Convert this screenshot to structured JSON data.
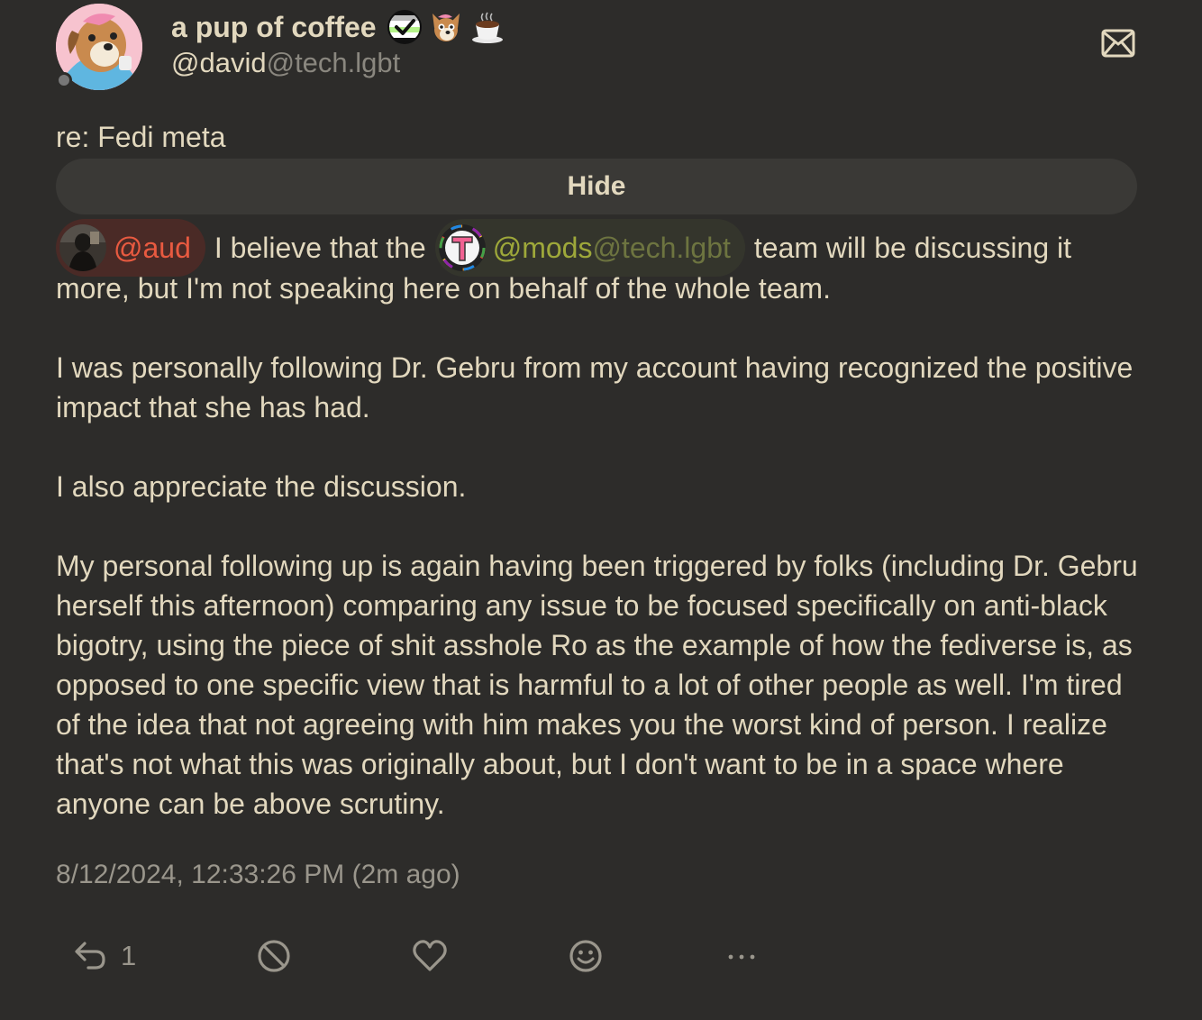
{
  "author": {
    "display_name": "a pup of coffee",
    "username": "@david",
    "host": "@tech.lgbt",
    "emojis": [
      "agender-check-emoji",
      "pup-face-emoji",
      "coffee-cup-emoji"
    ]
  },
  "note": {
    "cw": "re: Fedi meta",
    "hide_label": "Hide",
    "mention_1": "@aud",
    "text_1": "I believe that the",
    "mention_2_user": "@mods",
    "mention_2_host": "@tech.lgbt",
    "text_2": "team will be discussing it",
    "text_3": "more, but I'm not speaking here on behalf of the whole team.",
    "paragraph_2": "I was personally following Dr. Gebru from my account having recognized the positive impact that she has had.",
    "paragraph_3": "I also appreciate the discussion.",
    "paragraph_4": "My personal following up is again having been triggered by folks (including Dr. Gebru herself this afternoon) comparing any issue to be focused specifically on anti-black bigotry, using the piece of shit asshole Ro as the example of how the fediverse is, as opposed to one specific view that is harmful to a lot of other people as well. I'm tired of the idea that not agreeing with him makes you the worst kind of person. I realize that's not what this was originally about, but I don't want to be in a space where anyone can be above scrutiny.",
    "timestamp": "8/12/2024, 12:33:26 PM (2m ago)"
  },
  "actions": {
    "reply_count": "1",
    "icons": [
      "reply-icon",
      "renote-disabled-icon",
      "heart-icon",
      "emoji-reaction-icon",
      "more-icon"
    ]
  },
  "colors": {
    "background": "#2d2c2a",
    "text": "#e2d8be",
    "muted": "#9a968c",
    "mention_aud_bg": "#4a2a26",
    "mention_aud_fg": "#e85a40",
    "mention_mods_bg": "#34352c",
    "mention_mods_fg": "#9ea83a"
  }
}
